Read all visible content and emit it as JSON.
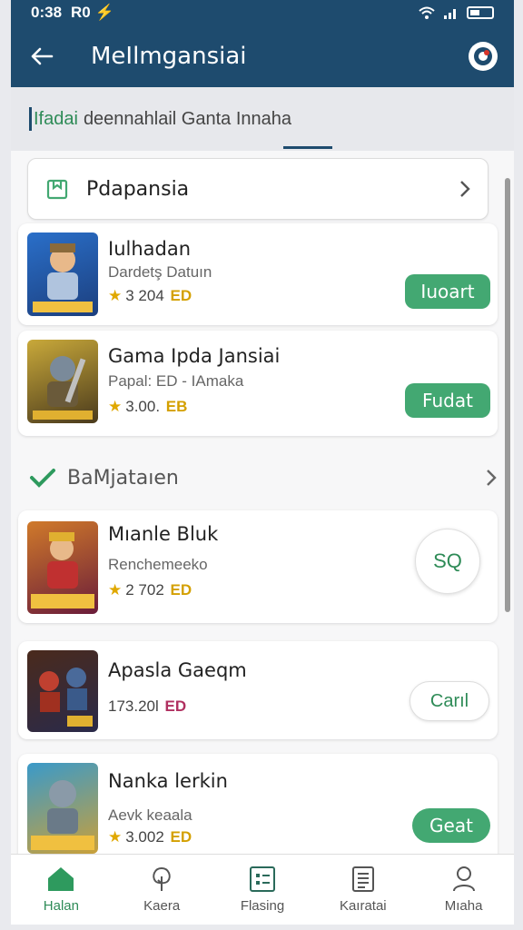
{
  "status": {
    "time": "0:38",
    "left_extra": "R0 ⚡"
  },
  "appbar": {
    "title": "MeIlmgansiai"
  },
  "search": {
    "accent": "Ifadai",
    "text": "deennahlail Ganta Innaha"
  },
  "category_card": {
    "label": "Pdapansia"
  },
  "apps": [
    {
      "name": "Iulhadan",
      "sub": "Dardetş Datuın",
      "rating": "3 204",
      "badge": "ED",
      "action": "Iuoart",
      "action_style": "green"
    },
    {
      "name": "Gama Ipda Jansiai",
      "sub": "Papal: ED - IAmaka",
      "rating": "3.00.",
      "badge": "EB",
      "action": "Fudat",
      "action_style": "green"
    }
  ],
  "section": {
    "label": "BaMjataıen"
  },
  "apps2": [
    {
      "name": "Mıanle Bluk",
      "sub": "Renchemeeko",
      "rating": "2 702",
      "badge": "ED",
      "action": "SQ",
      "action_style": "circle"
    },
    {
      "name": "Apasla Gaeqm",
      "sub": "",
      "rating": "173.20Ɩ",
      "badge": "ED",
      "action": "Carıl",
      "action_style": "outline"
    },
    {
      "name": "Nanka lerkin",
      "sub": "Aevk keaala",
      "rating": "3.002",
      "badge": "ED",
      "action": "Geat",
      "action_style": "green"
    }
  ],
  "nav": [
    {
      "label": "Halan",
      "icon": "home-icon",
      "active": true
    },
    {
      "label": "Kaera",
      "icon": "tree-icon",
      "active": false
    },
    {
      "label": "Flasing",
      "icon": "grid-icon",
      "active": false
    },
    {
      "label": "Kaıratai",
      "icon": "document-icon",
      "active": false
    },
    {
      "label": "Mıaha",
      "icon": "person-icon",
      "active": false
    }
  ],
  "colors": {
    "primary": "#1e4b6e",
    "accent": "#43a872",
    "star": "#e0a800"
  }
}
